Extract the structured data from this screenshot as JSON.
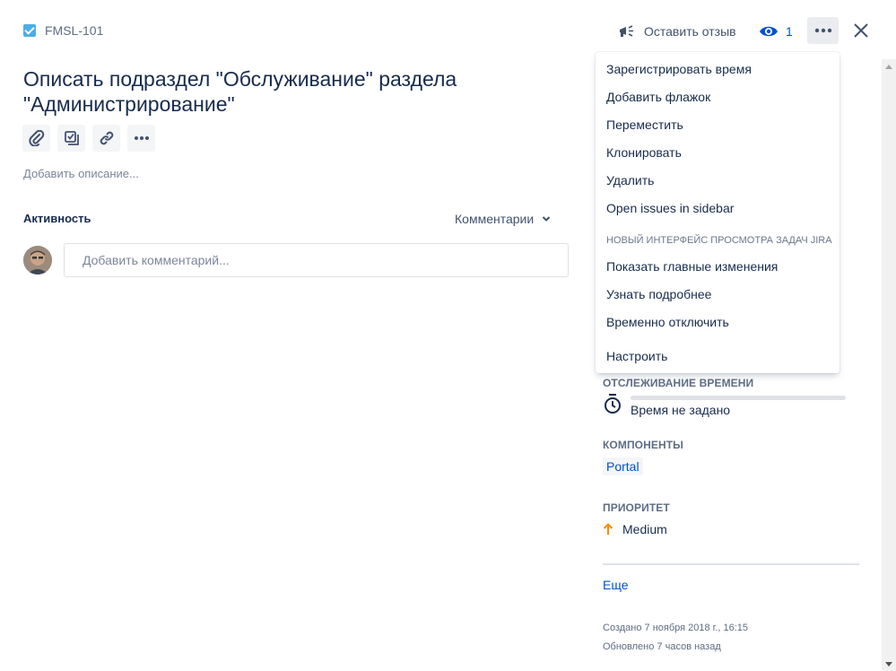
{
  "header": {
    "issue_key": "FMSL-101",
    "feedback_label": "Оставить отзыв",
    "watchers_count": "1"
  },
  "issue": {
    "title": "Описать подраздел \"Обслуживание\" раздела \"Администрирование\"",
    "add_description": "Добавить описание..."
  },
  "activity": {
    "label": "Активность",
    "filter": "Комментарии",
    "comment_placeholder": "Добавить комментарий..."
  },
  "menu": {
    "items": [
      "Зарегистрировать время",
      "Добавить флажок",
      "Переместить",
      "Клонировать",
      "Удалить",
      "Open issues in sidebar"
    ],
    "section_heading": "НОВЫЙ ИНТЕРФЕЙС ПРОСМОТРА ЗАДАЧ JIRA",
    "section_items": [
      "Показать главные изменения",
      "Узнать подробнее",
      "Временно отключить"
    ],
    "configure": "Настроить"
  },
  "sidebar": {
    "time_tracking_label": "ОТСЛЕЖИВАНИЕ ВРЕМЕНИ",
    "time_tracking_value": "Время не задано",
    "components_label": "КОМПОНЕНТЫ",
    "component": "Portal",
    "priority_label": "ПРИОРИТЕТ",
    "priority": "Medium",
    "more_link": "Еще",
    "created": "Создано 7 ноября 2018 г., 16:15",
    "updated": "Обновлено 7 часов назад"
  },
  "colors": {
    "link": "#0052cc",
    "text": "#172b4d",
    "subtle": "#5e6c84",
    "story_icon": "#4bade8",
    "priority_medium": "#ff8b00"
  }
}
